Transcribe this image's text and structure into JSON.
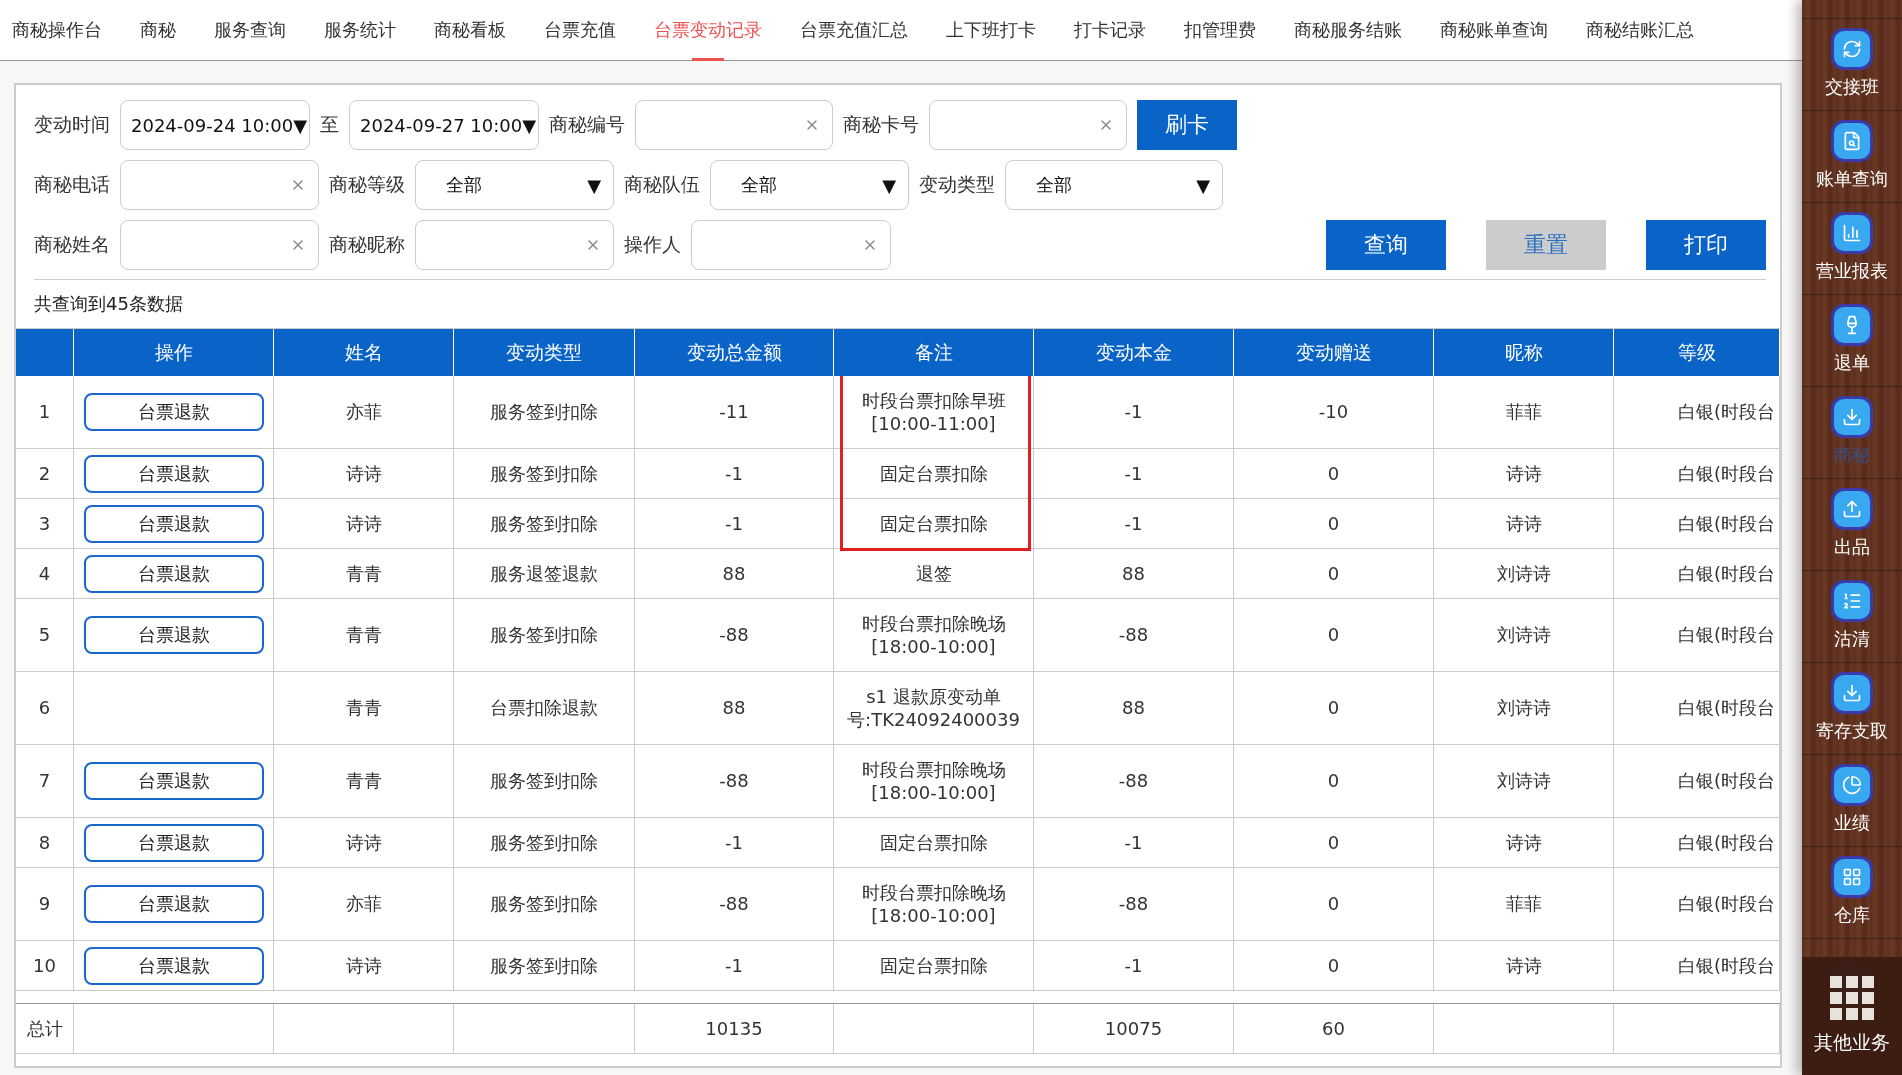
{
  "nav": [
    {
      "label": "商秘操作台",
      "selected": false
    },
    {
      "label": "商秘",
      "selected": false
    },
    {
      "label": "服务查询",
      "selected": false
    },
    {
      "label": "服务统计",
      "selected": false
    },
    {
      "label": "商秘看板",
      "selected": false
    },
    {
      "label": "台票充值",
      "selected": false
    },
    {
      "label": "台票变动记录",
      "selected": true
    },
    {
      "label": "台票充值汇总",
      "selected": false
    },
    {
      "label": "上下班打卡",
      "selected": false
    },
    {
      "label": "打卡记录",
      "selected": false
    },
    {
      "label": "扣管理费",
      "selected": false
    },
    {
      "label": "商秘服务结账",
      "selected": false
    },
    {
      "label": "商秘账单查询",
      "selected": false
    },
    {
      "label": "商秘结账汇总",
      "selected": false
    }
  ],
  "filters": {
    "time_label": "变动时间",
    "time_from": "2024-09-24 10:00▼",
    "to_label": "至",
    "time_to": "2024-09-27 10:00▼",
    "number_label": "商秘编号",
    "card_label": "商秘卡号",
    "swipe_button": "刷卡",
    "phone_label": "商秘电话",
    "level_label": "商秘等级",
    "level_value": "全部",
    "level_caret": "▼",
    "team_label": "商秘队伍",
    "team_value": "全部",
    "team_caret": "▼",
    "type_label": "变动类型",
    "type_value": "全部",
    "type_caret": "▼",
    "name_label": "商秘姓名",
    "nick_label": "商秘昵称",
    "operator_label": "操作人",
    "query_button": "查询",
    "reset_button": "重置",
    "print_button": "打印"
  },
  "result_count": "共查询到45条数据",
  "table": {
    "columns": [
      "操作",
      "姓名",
      "变动类型",
      "变动总金额",
      "备注",
      "变动本金",
      "变动赠送",
      "昵称",
      "等级"
    ],
    "rows": [
      {
        "index": "1",
        "action": "台票退款",
        "name": "亦菲",
        "type": "服务签到扣除",
        "total": "-11",
        "note": [
          "时段台票扣除早班",
          "[10:00-11:00]"
        ],
        "principal": "-1",
        "gift": "-10",
        "nickname": "菲菲",
        "level": "白银(时段台",
        "highlighted": true
      },
      {
        "index": "2",
        "action": "台票退款",
        "name": "诗诗",
        "type": "服务签到扣除",
        "total": "-1",
        "note": [
          "固定台票扣除"
        ],
        "principal": "-1",
        "gift": "0",
        "nickname": "诗诗",
        "level": "白银(时段台",
        "highlighted": true
      },
      {
        "index": "3",
        "action": "台票退款",
        "name": "诗诗",
        "type": "服务签到扣除",
        "total": "-1",
        "note": [
          "固定台票扣除"
        ],
        "principal": "-1",
        "gift": "0",
        "nickname": "诗诗",
        "level": "白银(时段台",
        "highlighted": true
      },
      {
        "index": "4",
        "action": "台票退款",
        "name": "青青",
        "type": "服务退签退款",
        "total": "88",
        "note": [
          "退签"
        ],
        "principal": "88",
        "gift": "0",
        "nickname": "刘诗诗",
        "level": "白银(时段台",
        "highlighted": false
      },
      {
        "index": "5",
        "action": "台票退款",
        "name": "青青",
        "type": "服务签到扣除",
        "total": "-88",
        "note": [
          "时段台票扣除晚场",
          "[18:00-10:00]"
        ],
        "principal": "-88",
        "gift": "0",
        "nickname": "刘诗诗",
        "level": "白银(时段台",
        "highlighted": false
      },
      {
        "index": "6",
        "name": "青青",
        "type": "台票扣除退款",
        "total": "88",
        "note": [
          "s1 退款原变动单",
          "号:TK24092400039"
        ],
        "principal": "88",
        "gift": "0",
        "nickname": "刘诗诗",
        "level": "白银(时段台",
        "highlighted": false
      },
      {
        "index": "7",
        "action": "台票退款",
        "name": "青青",
        "type": "服务签到扣除",
        "total": "-88",
        "note": [
          "时段台票扣除晚场",
          "[18:00-10:00]"
        ],
        "principal": "-88",
        "gift": "0",
        "nickname": "刘诗诗",
        "level": "白银(时段台",
        "highlighted": false
      },
      {
        "index": "8",
        "action": "台票退款",
        "name": "诗诗",
        "type": "服务签到扣除",
        "total": "-1",
        "note": [
          "固定台票扣除"
        ],
        "principal": "-1",
        "gift": "0",
        "nickname": "诗诗",
        "level": "白银(时段台",
        "highlighted": false
      },
      {
        "index": "9",
        "action": "台票退款",
        "name": "亦菲",
        "type": "服务签到扣除",
        "total": "-88",
        "note": [
          "时段台票扣除晚场",
          "[18:00-10:00]"
        ],
        "principal": "-88",
        "gift": "0",
        "nickname": "菲菲",
        "level": "白银(时段台",
        "highlighted": false
      },
      {
        "index": "10",
        "action": "台票退款",
        "name": "诗诗",
        "type": "服务签到扣除",
        "total": "-1",
        "note": [
          "固定台票扣除"
        ],
        "principal": "-1",
        "gift": "0",
        "nickname": "诗诗",
        "level": "白银(时段台",
        "highlighted": false
      }
    ],
    "footer": {
      "label": "总计",
      "total": "10135",
      "principal": "10075",
      "gift": "60"
    }
  },
  "sidebar": {
    "items": [
      {
        "label": "交接班",
        "selected": false
      },
      {
        "label": "账单查询",
        "selected": false
      },
      {
        "label": "营业报表",
        "selected": false
      },
      {
        "label": "退单",
        "selected": false
      },
      {
        "label": "商秘",
        "selected": true
      },
      {
        "label": "出品",
        "selected": false
      },
      {
        "label": "沽清",
        "selected": false
      },
      {
        "label": "寄存支取",
        "selected": false
      },
      {
        "label": "业绩",
        "selected": false
      },
      {
        "label": "仓库",
        "selected": false
      }
    ],
    "other": "其他业务"
  }
}
